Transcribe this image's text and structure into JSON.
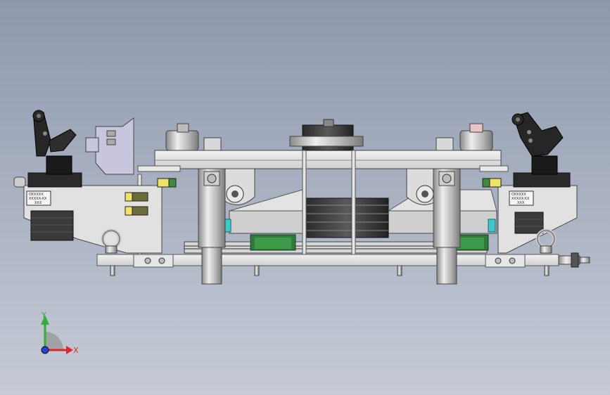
{
  "view": {
    "background_top": "#8d98ad",
    "background_bottom": "#c6cbd6"
  },
  "nameplates": {
    "left": [
      "OXXXXX",
      "XXXXX-XX",
      "XXX"
    ],
    "right": [
      "OXXXXX",
      "XXXXX-XX",
      "XXX"
    ]
  },
  "triad": {
    "y_label": "Y",
    "x_label": "X",
    "y_color": "#2fae3a",
    "x_color": "#d62a2a",
    "z_color": "#2a3fd6"
  }
}
